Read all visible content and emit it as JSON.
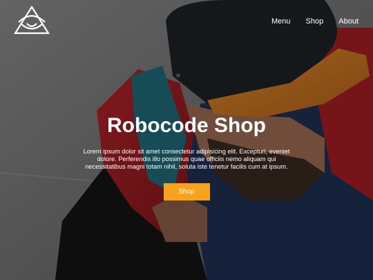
{
  "nav": {
    "logo_alt": "eye-triangle-logo",
    "items": [
      {
        "label": "Menu"
      },
      {
        "label": "Shop"
      },
      {
        "label": "About"
      }
    ]
  },
  "hero": {
    "title": "Robocode Shop",
    "description": "Lorem ipsum dolor sit amet consectetur adipisicing elit. Excepturi, eveniet dolore. Perferendis illo possimus quae officiis nemo aliquam qui necessitatibus magni totam nihil, soluta iste tenetur facilis cum at ipsum.",
    "button_label": "Shop"
  },
  "colors": {
    "accent": "#f7a21b",
    "text": "#ffffff"
  }
}
